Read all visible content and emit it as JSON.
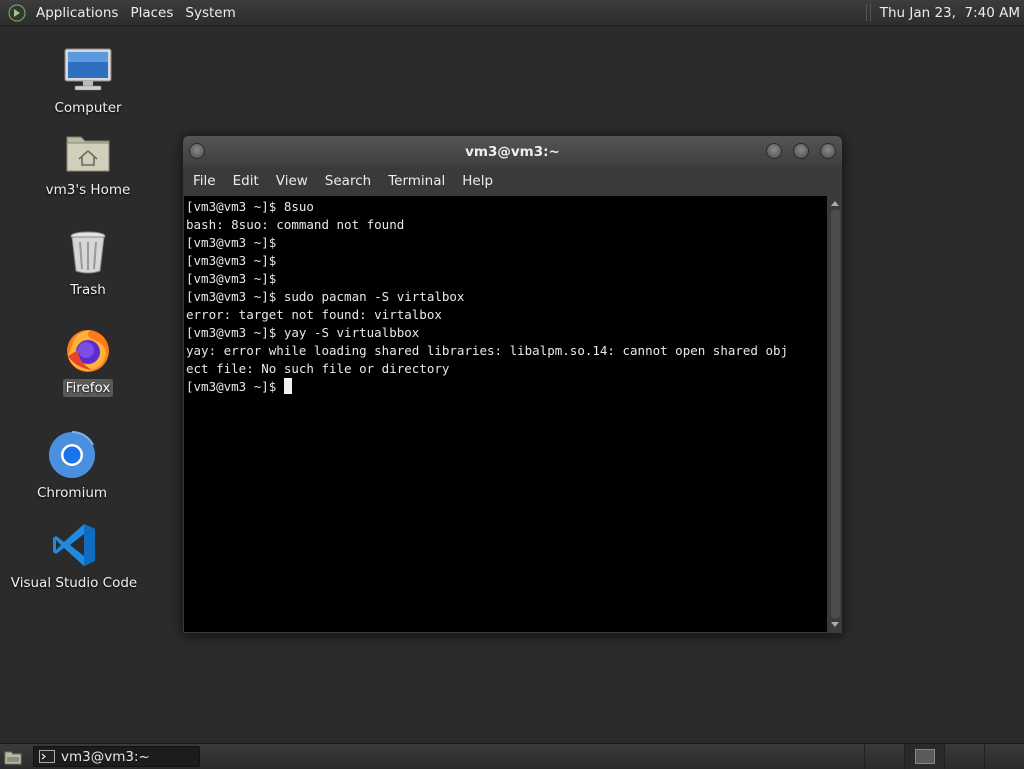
{
  "top_panel": {
    "menus": [
      "Applications",
      "Places",
      "System"
    ],
    "clock": "Thu Jan 23,  7:40 AM"
  },
  "desktop": {
    "icons": [
      {
        "label": "Computer",
        "icon": "computer-icon"
      },
      {
        "label": "vm3's Home",
        "icon": "home-folder-icon"
      },
      {
        "label": "Trash",
        "icon": "trash-icon"
      },
      {
        "label": "Firefox",
        "icon": "firefox-icon",
        "selected": true
      },
      {
        "label": "Chromium",
        "icon": "chromium-icon"
      },
      {
        "label": "Visual Studio Code",
        "icon": "vscode-icon"
      }
    ]
  },
  "window": {
    "title": "vm3@vm3:~",
    "menu": [
      "File",
      "Edit",
      "View",
      "Search",
      "Terminal",
      "Help"
    ]
  },
  "terminal": {
    "lines": [
      "[vm3@vm3 ~]$ 8suo",
      "bash: 8suo: command not found",
      "[vm3@vm3 ~]$ ",
      "[vm3@vm3 ~]$ ",
      "[vm3@vm3 ~]$ ",
      "[vm3@vm3 ~]$ sudo pacman -S virtalbox",
      "error: target not found: virtalbox",
      "[vm3@vm3 ~]$ yay -S virtualbbox",
      "yay: error while loading shared libraries: libalpm.so.14: cannot open shared obj",
      "ect file: No such file or directory",
      "[vm3@vm3 ~]$ "
    ]
  },
  "taskbar": {
    "task_label": "vm3@vm3:~"
  }
}
